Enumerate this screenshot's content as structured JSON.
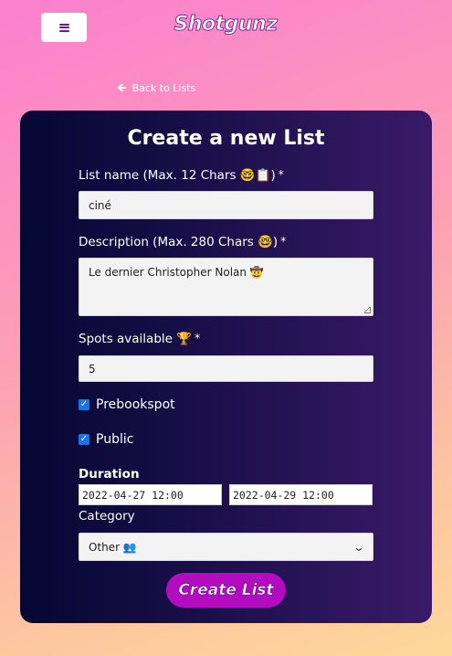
{
  "header": {
    "brand": "Shotgunz",
    "menu_icon": "hamburger-icon"
  },
  "back_link": {
    "label": "Back to Lists",
    "icon": "arrow-left-icon"
  },
  "form": {
    "title": "Create a new List",
    "list_name": {
      "label": "List name (Max. 12 Chars 🤓📋)",
      "required_mark": "*",
      "value": "ciné"
    },
    "description": {
      "label": "Description (Max. 280 Chars 🤓)",
      "required_mark": "*",
      "value": "Le dernier Christopher Nolan 🤠"
    },
    "spots": {
      "label": "Spots available 🏆",
      "required_mark": "*",
      "value": "5"
    },
    "prebookspot": {
      "label": "Prebookspot",
      "checked": true
    },
    "public": {
      "label": "Public",
      "checked": true
    },
    "duration": {
      "label": "Duration",
      "start": "2022-04-27 12:00",
      "end": "2022-04-29 12:00"
    },
    "category": {
      "label": "Category",
      "selected": "Other 👥"
    },
    "submit_label": "Create List"
  },
  "colors": {
    "accent": "#b30cc0",
    "checkbox": "#1a73e8"
  }
}
